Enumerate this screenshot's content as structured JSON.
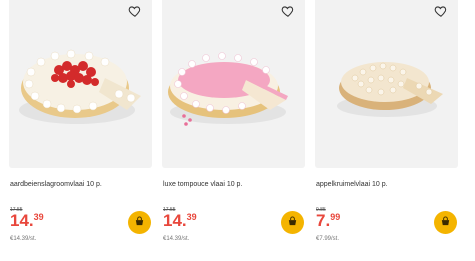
{
  "products": [
    {
      "name": "aardbeienslagroomvlaai 10 p.",
      "old_price": "17.55",
      "price_int": "14.",
      "price_dec": "39",
      "unit_price": "€14.39/st.",
      "image": "strawberry-cream-pie"
    },
    {
      "name": "luxe tompouce vlaai 10 p.",
      "old_price": "17.55",
      "price_int": "14.",
      "price_dec": "39",
      "unit_price": "€14.39/st.",
      "image": "pink-tompouce-pie"
    },
    {
      "name": "appelkruimelvlaai 10 p.",
      "old_price": "9.85",
      "price_int": "7.",
      "price_dec": "99",
      "unit_price": "€7.99/st.",
      "image": "apple-crumble-pie"
    }
  ],
  "icons": {
    "favorite": "heart-outline-icon",
    "add_to_cart": "shopping-basket-icon"
  },
  "colors": {
    "price": "#e8473c",
    "cart_button": "#f4b400",
    "image_background": "#f2f2f2"
  }
}
